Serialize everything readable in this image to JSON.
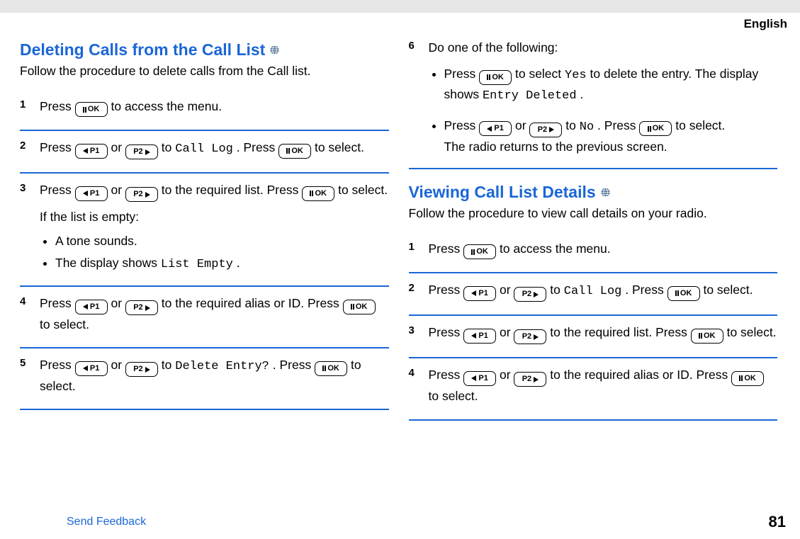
{
  "header": {
    "language": "English"
  },
  "leftColumn": {
    "title": "Deleting Calls from the Call List",
    "intro": "Follow the procedure to delete calls from the Call list.",
    "steps": {
      "s1": {
        "num": "1",
        "a": "Press ",
        "b": " to access the menu."
      },
      "s2": {
        "num": "2",
        "a": "Press ",
        "b": " or ",
        "c": " to ",
        "d": "Call Log",
        "e": ". Press ",
        "f": " to select."
      },
      "s3": {
        "num": "3",
        "a": "Press ",
        "b": " or ",
        "c": " to the required list. Press ",
        "d": " to select.",
        "note": "If the list is empty:",
        "li1": "A tone sounds.",
        "li2a": "The display shows ",
        "li2b": "List Empty",
        "li2c": "."
      },
      "s4": {
        "num": "4",
        "a": "Press ",
        "b": " or ",
        "c": " to the required alias or ID. Press ",
        "d": " to select."
      },
      "s5": {
        "num": "5",
        "a": "Press ",
        "b": " or ",
        "c": " to ",
        "d": "Delete Entry?",
        "e": ". Press ",
        "f": " to select."
      }
    }
  },
  "rightColumn": {
    "step6": {
      "num": "6",
      "lead": "Do one of the following:",
      "opt1": {
        "a": "Press ",
        "b": " to select ",
        "c": "Yes",
        "d": " to delete the entry. The display shows ",
        "e": "Entry Deleted",
        "f": "."
      },
      "opt2": {
        "a": "Press ",
        "b": " or ",
        "c": " to ",
        "d": "No",
        "e": ". Press ",
        "f": " to select.",
        "g": "The radio returns to the previous screen."
      }
    },
    "title2": "Viewing Call List Details",
    "intro2": "Follow the procedure to view call details on your radio.",
    "steps": {
      "s1": {
        "num": "1",
        "a": "Press ",
        "b": " to access the menu."
      },
      "s2": {
        "num": "2",
        "a": "Press ",
        "b": " or ",
        "c": " to ",
        "d": "Call Log",
        "e": ". Press ",
        "f": " to select."
      },
      "s3": {
        "num": "3",
        "a": "Press ",
        "b": " or ",
        "c": " to the required list. Press ",
        "d": " to select."
      },
      "s4": {
        "num": "4",
        "a": "Press ",
        "b": " or ",
        "c": " to the required alias or ID. Press ",
        "d": " to select."
      }
    }
  },
  "footer": {
    "feedback": "Send Feedback",
    "page": "81"
  },
  "buttons": {
    "ok": "OK",
    "p1": "P1",
    "p2": "P2"
  }
}
